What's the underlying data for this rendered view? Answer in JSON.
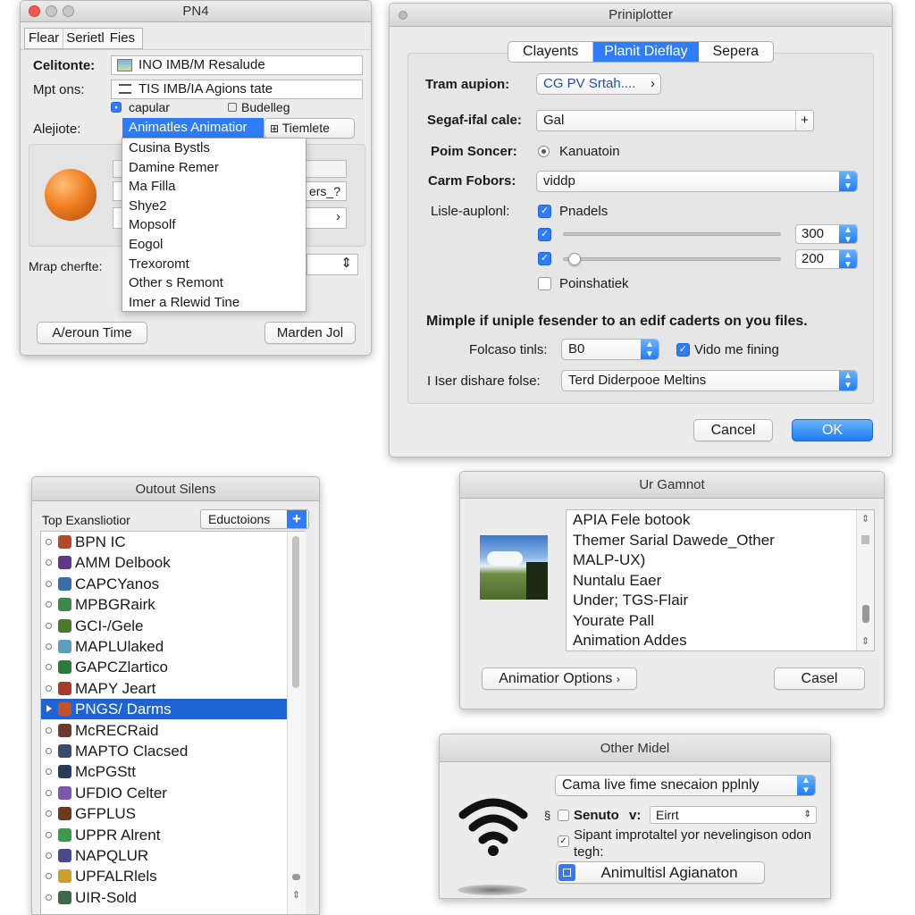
{
  "w1": {
    "title": "PN4",
    "tabs": [
      "Flear",
      "Serietl",
      "Fies"
    ],
    "label_source": "Celitonte:",
    "source_value": "INO IMB/M Resalude",
    "label_options": "Mpt ons:",
    "options_value": "TIS IMB/IA Agions tate",
    "chk_capular": "capular",
    "chk_budelleg": "Budelleg",
    "label_alignment": "Alejiote:",
    "alignment_selected": "Animatles Animatior",
    "template_label": "Tiemlete",
    "menu_items": [
      "Cusina Bystls",
      "Damine Remer",
      "Ma Filla",
      "Shye2",
      "Mopsolf",
      "Eogol",
      "Trexoromt",
      "Other s Remont",
      "Imer a Rlewid Tine"
    ],
    "behind_field": "ers_?",
    "label_map": "Mrap cherfte:",
    "btn_left": "A/eroun Time",
    "btn_right": "Marden Jol"
  },
  "w2": {
    "title": "Priniplotter",
    "tabs": [
      "Clayents",
      "Planit Dieflay",
      "Sepera"
    ],
    "label_tram": "Tram aupion:",
    "tram_value": "CG PV Srtah....",
    "label_scale": "Segaf-ifal cale:",
    "scale_value": "Gal",
    "label_poim": "Poim Soncer:",
    "poim_value": "Kanuatoin",
    "label_carm": "Carm Fobors:",
    "carm_value": "viddp",
    "label_lisle": "Lisle-auplonl:",
    "chk_pnadels": "Pnadels",
    "slider1_value": "300",
    "slider1_level": 0.0,
    "slider2_value": "200",
    "slider2_level": 0.05,
    "chk_poinshatiek": "Poinshatiek",
    "notice": "Mimple if uniple fesender to an edif caderts on you files.",
    "label_folcaso": "Folcaso tinls:",
    "folcaso_value": "B0",
    "chk_vido": "Vido me fining",
    "label_user": "I Iser dishare folse:",
    "user_value": "Terd Diderpooe Meltins",
    "cancel": "Cancel",
    "ok": "OK"
  },
  "w3": {
    "title": "Outout Silens",
    "header_label": "Top Exansliotior",
    "header_button": "Eductoions",
    "items": [
      "BPN IC",
      "AMM Delbook",
      "CAPCYanos",
      "MPBGRairk",
      "GCI-/Gele",
      "MAPLUlaked",
      "GAPCZlartico",
      "MAPY Jeart",
      "PNGS/ Darms",
      "McRECRaid",
      "MAPTO Clacsed",
      "McPGStt",
      "UFDIO Celter",
      "GFPLUS",
      "UPPR Alrent",
      "NAPQLUR",
      "UPFALRlels",
      "UIR-Sold"
    ],
    "selected_index": 8
  },
  "w4": {
    "title": "Ur Gamnot",
    "items": [
      "APIA Fele botook",
      "Themer Sarial Dawede_Other",
      "MALP-UX)",
      "Nuntalu Eaer",
      "Under; TGS-Flair",
      "Yourate Pall",
      "Animation Addes"
    ],
    "btn_options": "Animatior Options",
    "btn_cancel": "Casel"
  },
  "w5": {
    "title": "Other Midel",
    "popup_value": "Cama live fime snecaion pplnly",
    "label_senuto": "Senuto",
    "senuto_v": "v:",
    "senuto_value": "Eirrt",
    "chk_sipant": "Sipant improtaltel yor nevelingison odon tegh:",
    "btn_anim": "Animultisl Agianaton"
  }
}
